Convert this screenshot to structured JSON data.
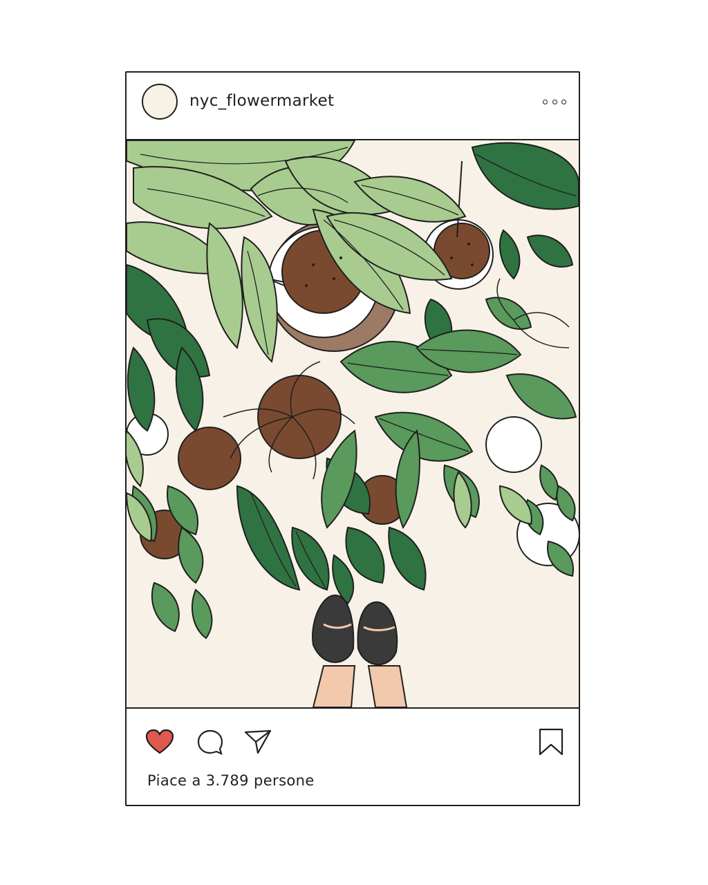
{
  "post": {
    "username": "nyc_flowermarket",
    "likes_text": "Piace a  3.789 persone",
    "liked": true
  },
  "icons": {
    "avatar": "avatar-circle",
    "more": "more-dots-icon",
    "like": "heart-icon",
    "comment": "comment-bubble-icon",
    "share": "paper-plane-icon",
    "save": "bookmark-icon"
  },
  "colors": {
    "heart": "#e0584e",
    "background": "#f7f1e7",
    "leaf_light": "#a8cc8f",
    "leaf_mid": "#5a9a5c",
    "leaf_dark": "#2f7342",
    "soil": "#7a4a30",
    "shoe": "#3a3a3a"
  }
}
